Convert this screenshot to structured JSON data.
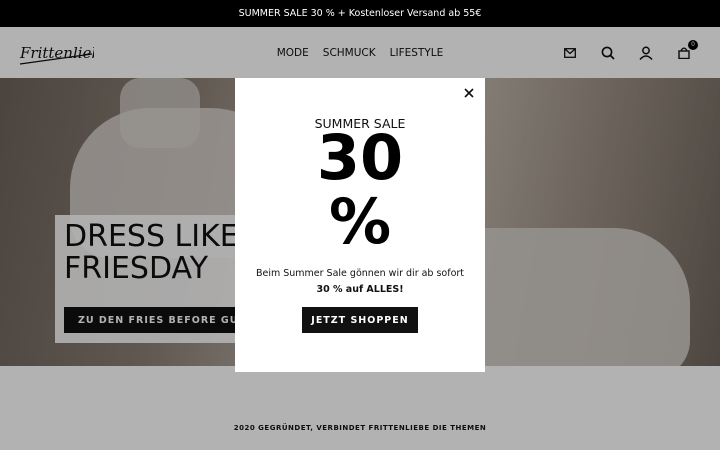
{
  "announcement": {
    "text": "SUMMER SALE 30 % + Kostenloser Versand ab 55€"
  },
  "header": {
    "logo_text": "Frittenliebe",
    "nav": [
      "MODE",
      "SCHMUCK",
      "LIFESTYLE"
    ],
    "icons": [
      "mail-icon",
      "search-icon",
      "account-icon",
      "cart-icon"
    ],
    "cart_count": "0"
  },
  "hero": {
    "title_line1": "DRESS LIKE",
    "title_line2": "FRIESDAY",
    "button_label": "ZU DEN FRIES BEFORE GUYS"
  },
  "strip": {
    "text": "2020 GEGRÜNDET, VERBINDET FRITTENLIEBE DIE THEMEN"
  },
  "modal": {
    "label": "SUMMER SALE",
    "big_number": "30",
    "big_percent": "%",
    "text_before": "Beim Summer Sale gönnen wir dir ab sofort ",
    "text_bold": "30 % auf ALLES!",
    "button_label": "JETZT SHOPPEN"
  }
}
